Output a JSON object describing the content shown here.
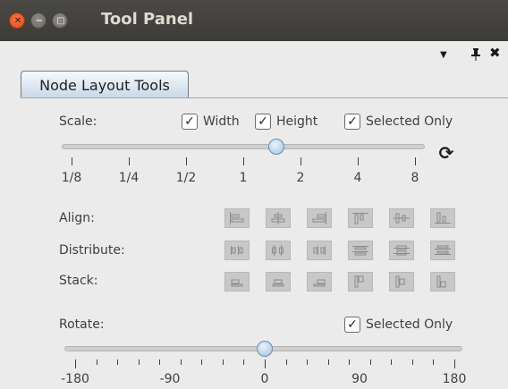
{
  "window": {
    "title": "Tool Panel"
  },
  "tab": {
    "label": "Node Layout Tools"
  },
  "scale": {
    "label": "Scale:",
    "width_label": "Width",
    "height_label": "Height",
    "selected_only_label": "Selected Only",
    "tick_labels": [
      "1/8",
      "1/4",
      "1/2",
      "1",
      "2",
      "4",
      "8"
    ],
    "current_value": 1.5
  },
  "align": {
    "label": "Align:"
  },
  "distribute": {
    "label": "Distribute:"
  },
  "stack": {
    "label": "Stack:"
  },
  "rotate": {
    "label": "Rotate:",
    "selected_only_label": "Selected Only",
    "tick_labels": [
      "-180",
      "-90",
      "0",
      "90",
      "180"
    ],
    "value": 0
  },
  "icons": {
    "window_close": "close-icon",
    "window_minimize": "minimize-icon",
    "window_maximize": "maximize-icon",
    "dock_menu": "dropdown-arrow-icon",
    "dock_pin": "pin-icon",
    "dock_close": "close-icon",
    "refresh": "refresh-icon",
    "check": "checkmark-icon"
  },
  "colors": {
    "titlebar": "#3c3b37",
    "close_button": "#df4a16",
    "slider_thumb": "#9fc1df",
    "panel_bg": "#ebebeb"
  }
}
